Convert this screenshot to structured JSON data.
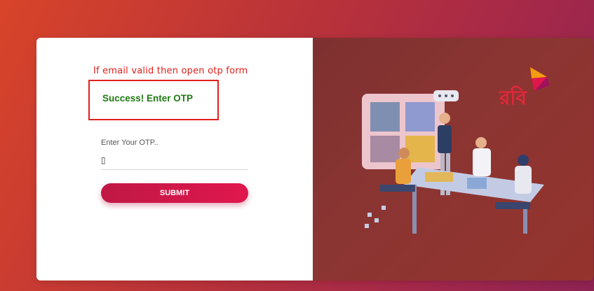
{
  "annotation": "If email valid then open otp form",
  "alert": {
    "message": "Success! Enter OTP",
    "color": "#1f7a12"
  },
  "otp_form": {
    "label": "Enter Your OTP..",
    "value": "▯",
    "submit_label": "SUBMIT"
  },
  "brand": {
    "logo_text": "রবি",
    "accent": "#e0174d"
  }
}
